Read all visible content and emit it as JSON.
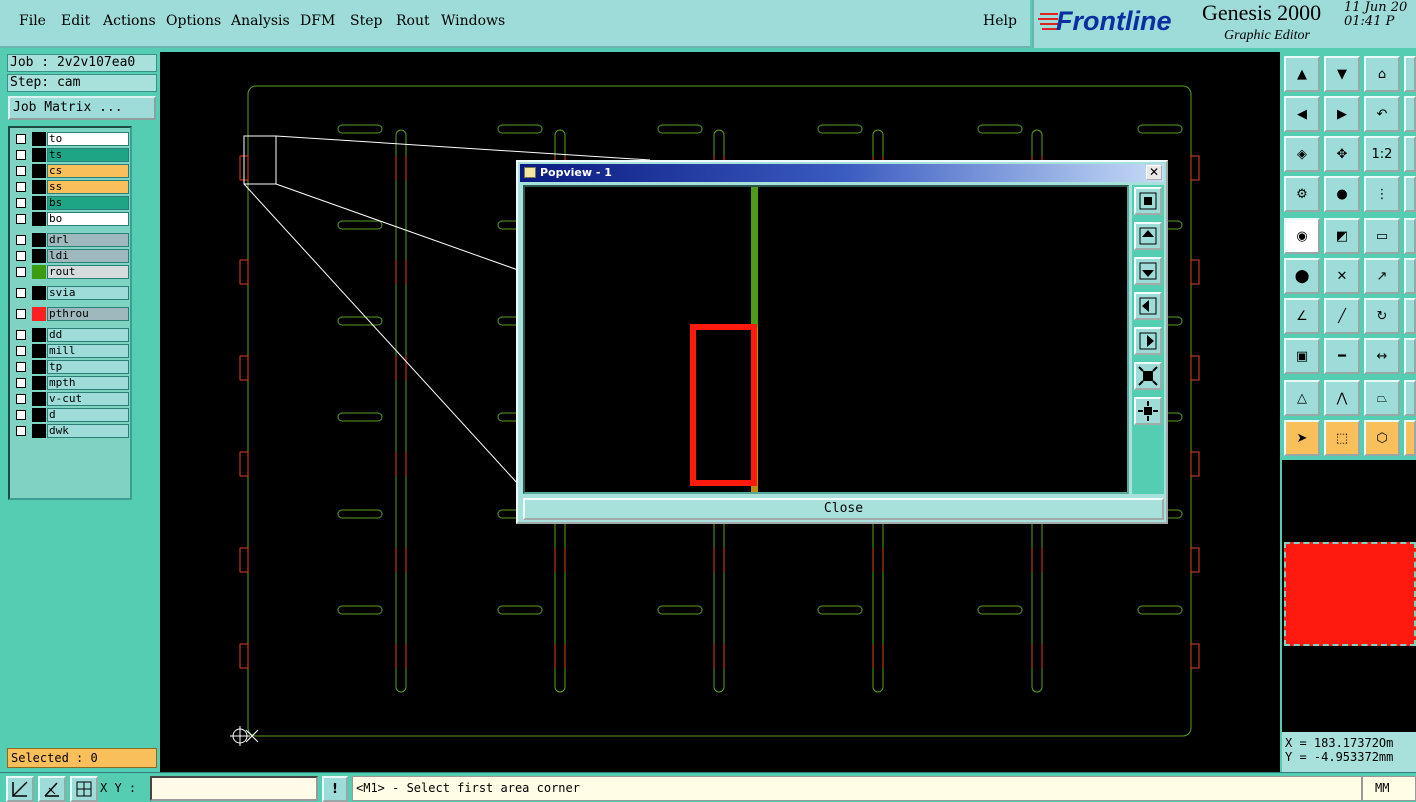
{
  "menu": {
    "items": [
      "File",
      "Edit",
      "Actions",
      "Options",
      "Analysis",
      "DFM",
      "Step",
      "Rout",
      "Windows"
    ],
    "help": "Help"
  },
  "brand": {
    "logo": "Frontline",
    "product": "Genesis 2000",
    "subtitle": "Graphic Editor",
    "date": "11 Jun 20",
    "time": "01:41 P"
  },
  "job": {
    "job_label": "Job : 2v2v107ea0",
    "step_label": "Step: cam",
    "matrix_button": "Job Matrix ..."
  },
  "layers": [
    {
      "name": "to",
      "color": "#ffffff",
      "swatch": "#000000"
    },
    {
      "name": "ts",
      "color": "#1ea585",
      "swatch": "#000000"
    },
    {
      "name": "cs",
      "color": "#f9bf5a",
      "swatch": "#000000"
    },
    {
      "name": "ss",
      "color": "#f9bf5a",
      "swatch": "#000000"
    },
    {
      "name": "bs",
      "color": "#1ea585",
      "swatch": "#000000"
    },
    {
      "name": "bo",
      "color": "#ffffff",
      "swatch": "#000000"
    },
    {
      "name": "drl",
      "color": "#9fb8bd",
      "swatch": "#000000"
    },
    {
      "name": "ldi",
      "color": "#9fb8bd",
      "swatch": "#000000"
    },
    {
      "name": "rout",
      "color": "#d4dcdc",
      "swatch": "#3c9d14"
    },
    {
      "name": "svia",
      "color": "#9ddcd9",
      "swatch": "#000000"
    },
    {
      "name": "pthrou",
      "color": "#9fb8bd",
      "swatch": "#ff2020"
    },
    {
      "name": "dd",
      "color": "#9ddcd9",
      "swatch": "#000000"
    },
    {
      "name": "mill",
      "color": "#9ddcd9",
      "swatch": "#000000"
    },
    {
      "name": "tp",
      "color": "#9ddcd9",
      "swatch": "#000000"
    },
    {
      "name": "mpth",
      "color": "#9ddcd9",
      "swatch": "#000000"
    },
    {
      "name": "v-cut",
      "color": "#9ddcd9",
      "swatch": "#000000"
    },
    {
      "name": "d",
      "color": "#9ddcd9",
      "swatch": "#000000"
    },
    {
      "name": "dwk",
      "color": "#9ddcd9",
      "swatch": "#000000"
    }
  ],
  "selected": "Selected : 0",
  "popview": {
    "title": "Popview - 1",
    "close_button": "Close",
    "close_x": "✕"
  },
  "coords": {
    "x": "X = 183.17372Om",
    "y": "Y = -4.953372mm"
  },
  "bottom": {
    "xy_label": "X Y :",
    "xy_value": "",
    "prompt": "<M1> - Select first area corner",
    "units": "MM",
    "info_icon": "!"
  },
  "right_tools": {
    "zoom_ratio": "1:2"
  }
}
